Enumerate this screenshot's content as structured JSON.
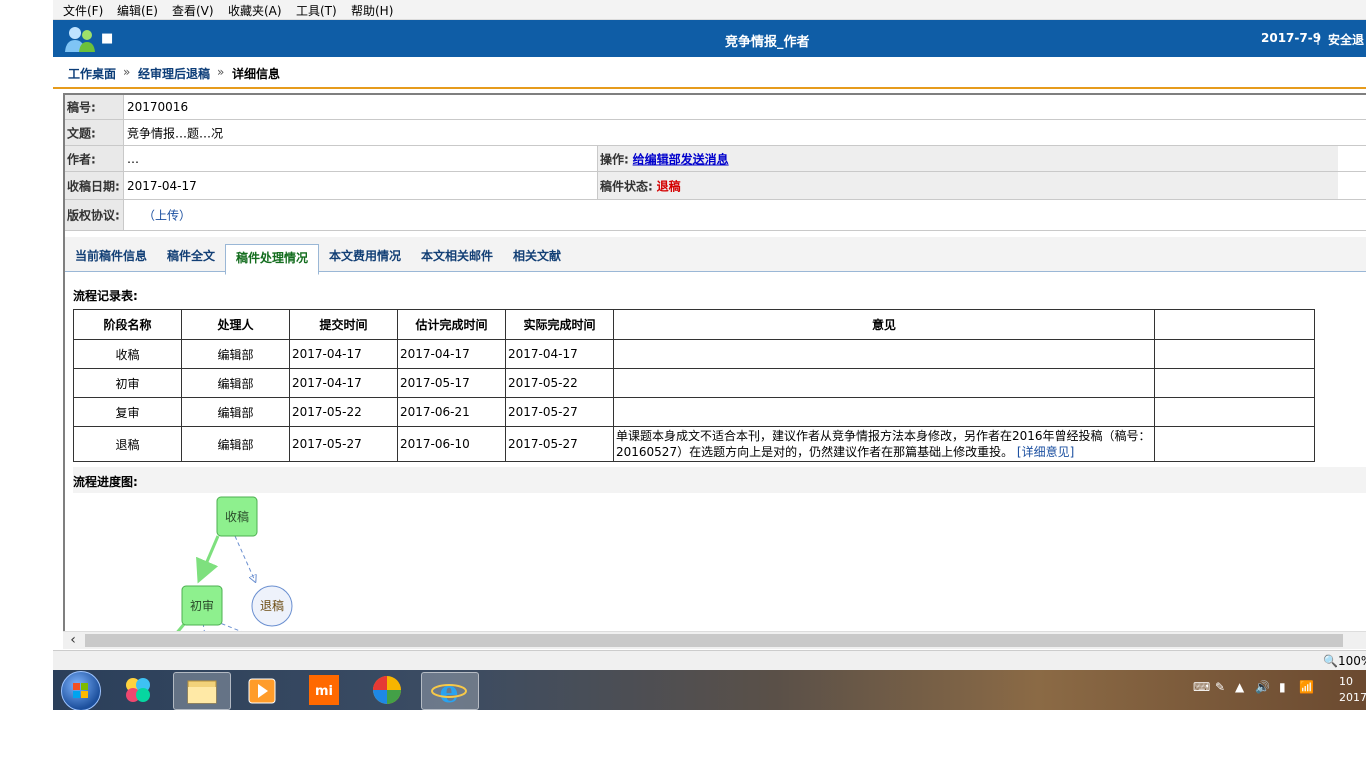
{
  "menu": [
    "文件(F)",
    "编辑(E)",
    "查看(V)",
    "收藏夹(A)",
    "工具(T)",
    "帮助(H)"
  ],
  "header": {
    "user_name": "■",
    "title": "竞争情报_作者",
    "date": "2017-7-9",
    "separator": "|",
    "logout": "安全退"
  },
  "breadcrumb": {
    "items": [
      "工作桌面",
      "经审理后退稿",
      "详细信息"
    ],
    "arrow": "»"
  },
  "info": {
    "id_label": "稿号:",
    "id_value": "20170016",
    "title_label": "文题:",
    "title_value": "竞争情报…题…况",
    "author_label": "作者:",
    "author_value": "…",
    "action_label": "操作:",
    "action_link": "给编辑部发送消息",
    "date_label": "收稿日期:",
    "date_value": "2017-04-17",
    "status_label": "稿件状态:",
    "status_value": "退稿",
    "status_color": "#d40000",
    "copyright_label": "版权协议:",
    "copyright_value": "（上传）"
  },
  "tabs": [
    "当前稿件信息",
    "稿件全文",
    "稿件处理情况",
    "本文费用情况",
    "本文相关邮件",
    "相关文献"
  ],
  "active_tab": "稿件处理情况",
  "process": {
    "title": "流程记录表:",
    "columns": [
      "阶段名称",
      "处理人",
      "提交时间",
      "估计完成时间",
      "实际完成时间",
      "意见",
      ""
    ],
    "rows": [
      {
        "stage": "收稿",
        "handler": "编辑部",
        "submit": "2017-04-17",
        "estimate": "2017-04-17",
        "actual": "2017-04-17",
        "opinion": "",
        "more": ""
      },
      {
        "stage": "初审",
        "handler": "编辑部",
        "submit": "2017-04-17",
        "estimate": "2017-05-17",
        "actual": "2017-05-22",
        "opinion": "",
        "more": ""
      },
      {
        "stage": "复审",
        "handler": "编辑部",
        "submit": "2017-05-22",
        "estimate": "2017-06-21",
        "actual": "2017-05-27",
        "opinion": "",
        "more": ""
      },
      {
        "stage": "退稿",
        "handler": "编辑部",
        "submit": "2017-05-27",
        "estimate": "2017-06-10",
        "actual": "2017-05-27",
        "opinion": " 单课题本身成文不适合本刊，建议作者从竞争情报方法本身修改，另作者在2016年曾经投稿（稿号：20160527）在选题方向上是对的，仍然建议作者在那篇基础上修改重投。",
        "more": "[详细意见]"
      }
    ]
  },
  "flow": {
    "title": "流程进度图:",
    "nodes": {
      "received": "收稿",
      "first_review": "初审",
      "rejected": "退稿"
    },
    "colors": {
      "node_fill": "#8ef08e",
      "node_border": "#4caf50",
      "arrow": "#7ee07e",
      "dashed": "#6a8fd0"
    }
  },
  "statusbar": {
    "zoom": "100%"
  },
  "taskbar": {
    "icons": [
      "windows-start-icon",
      "color-flower-app-icon",
      "file-explorer-icon",
      "media-player-icon",
      "xiaomi-icon",
      "colorful-ball-app-icon",
      "internet-explorer-icon"
    ],
    "clock_time": "10",
    "clock_date": "2017"
  }
}
